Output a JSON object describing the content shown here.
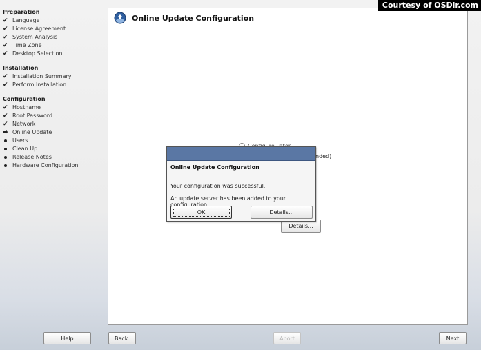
{
  "watermark": "Courtesy of OSDir.com",
  "sidebar": {
    "sections": [
      {
        "title": "Preparation",
        "items": [
          {
            "label": "Language",
            "state": "done"
          },
          {
            "label": "License Agreement",
            "state": "done"
          },
          {
            "label": "System Analysis",
            "state": "done"
          },
          {
            "label": "Time Zone",
            "state": "done"
          },
          {
            "label": "Desktop Selection",
            "state": "done"
          }
        ]
      },
      {
        "title": "Installation",
        "items": [
          {
            "label": "Installation Summary",
            "state": "done"
          },
          {
            "label": "Perform Installation",
            "state": "done"
          }
        ]
      },
      {
        "title": "Configuration",
        "items": [
          {
            "label": "Hostname",
            "state": "done"
          },
          {
            "label": "Root Password",
            "state": "done"
          },
          {
            "label": "Network",
            "state": "done"
          },
          {
            "label": "Online Update",
            "state": "current"
          },
          {
            "label": "Users",
            "state": "pending"
          },
          {
            "label": "Clean Up",
            "state": "pending"
          },
          {
            "label": "Release Notes",
            "state": "pending"
          },
          {
            "label": "Hardware Configuration",
            "state": "pending"
          }
        ]
      }
    ]
  },
  "content": {
    "title": "Online Update Configuration",
    "background": {
      "radio_label": "Configure Later",
      "recommended_fragment": "nded)",
      "details_button": "Details..."
    }
  },
  "dialog": {
    "titlebar_color": "#5a77a4",
    "heading": "Online Update Configuration",
    "message1": "Your configuration was successful.",
    "message2": "An update server has been added to your configuration.",
    "ok_button": "OK",
    "details_button": "Details..."
  },
  "footer": {
    "help": "Help",
    "back": "Back",
    "abort": "Abort",
    "next": "Next"
  }
}
